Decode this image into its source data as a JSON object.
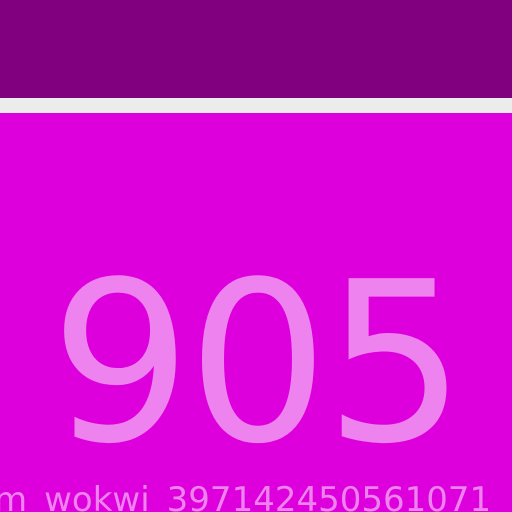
{
  "colors": {
    "background": "#ececec",
    "top_bar": "#800080",
    "panel": "#dd00dd",
    "text": "#ee82ee"
  },
  "counter": {
    "value": "905"
  },
  "footer": {
    "label": "m_wokwi_397142450561071"
  }
}
